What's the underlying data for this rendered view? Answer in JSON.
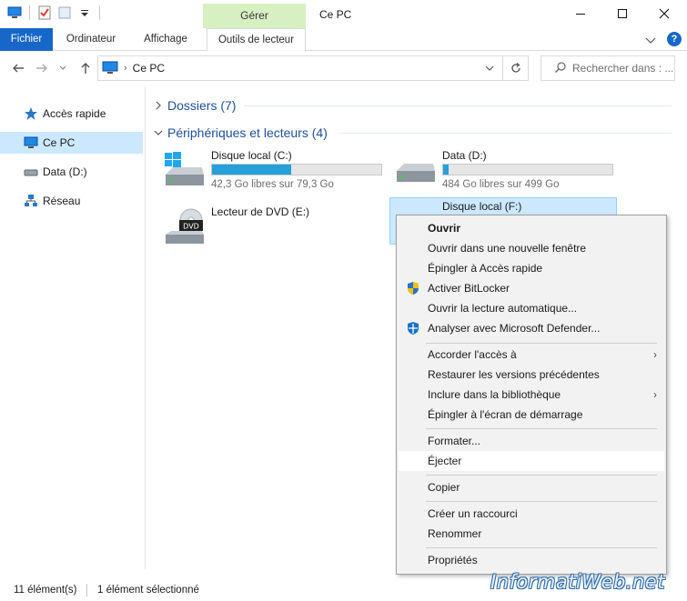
{
  "window": {
    "title": "Ce PC",
    "context_tab_group": "Gérer"
  },
  "ribbon": {
    "tabs": [
      {
        "label": "Fichier"
      },
      {
        "label": "Ordinateur"
      },
      {
        "label": "Affichage"
      },
      {
        "label": "Outils de lecteur"
      }
    ],
    "help_label": "?"
  },
  "address": {
    "crumb_separator": "›",
    "current": "Ce PC",
    "search_placeholder": "Rechercher dans : ..."
  },
  "sidebar": {
    "items": [
      {
        "label": "Accès rapide",
        "icon": "star-icon"
      },
      {
        "label": "Ce PC",
        "icon": "computer-icon",
        "selected": true
      },
      {
        "label": "Data (D:)",
        "icon": "drive-icon"
      },
      {
        "label": "Réseau",
        "icon": "network-icon"
      }
    ]
  },
  "groups": {
    "folders": "Dossiers (7)",
    "devices": "Périphériques et lecteurs (4)"
  },
  "drives": [
    {
      "name": "Disque local (C:)",
      "info": "42,3 Go libres sur 79,3 Go",
      "used_fraction": 0.467,
      "icon": "windows-drive-icon"
    },
    {
      "name": "Data (D:)",
      "info": "484 Go libres sur 499 Go",
      "used_fraction": 0.03,
      "icon": "hard-drive-icon"
    },
    {
      "name": "Lecteur de DVD (E:)",
      "icon": "dvd-drive-icon",
      "badge": "DVD"
    },
    {
      "name": "Disque local (F:)",
      "selected": true
    }
  ],
  "context_menu": {
    "items": [
      {
        "label": "Ouvrir",
        "bold": true
      },
      {
        "label": "Ouvrir dans une nouvelle fenêtre"
      },
      {
        "label": "Épingler à Accès rapide"
      },
      {
        "label": "Activer BitLocker",
        "icon": "shield-icon"
      },
      {
        "label": "Ouvrir la lecture automatique..."
      },
      {
        "label": "Analyser avec Microsoft Defender...",
        "icon": "defender-icon"
      },
      {
        "label": "Accorder l'accès à",
        "submenu": true
      },
      {
        "label": "Restaurer les versions précédentes"
      },
      {
        "label": "Inclure dans la bibliothèque",
        "submenu": true
      },
      {
        "label": "Épingler à l'écran de démarrage"
      },
      {
        "label": "Formater..."
      },
      {
        "label": "Éjecter",
        "hover": true
      },
      {
        "label": "Copier"
      },
      {
        "label": "Créer un raccourci"
      },
      {
        "label": "Renommer"
      },
      {
        "label": "Propriétés"
      }
    ],
    "submenu_arrow": "›"
  },
  "status": {
    "count": "11 élément(s)",
    "selection": "1 élément sélectionné"
  },
  "watermark": "InformatiWeb.net",
  "colors": {
    "accent": "#1667c9",
    "context_tab": "#d7f0c2",
    "selection": "#cce8ff",
    "drive_bar": "#26a0da",
    "group_header": "#1e4e9c"
  }
}
